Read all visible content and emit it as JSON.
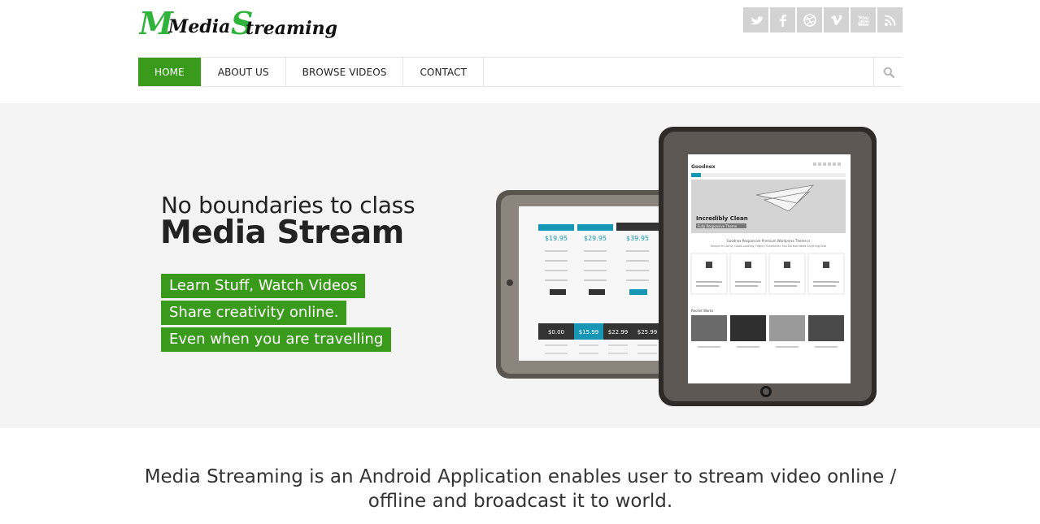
{
  "header": {
    "logo": {
      "part1": "Media",
      "part2": "Streaming"
    },
    "social_icons": [
      "twitter-icon",
      "facebook-icon",
      "dribbble-icon",
      "vimeo-icon",
      "youtube-icon",
      "rss-icon"
    ]
  },
  "nav": {
    "items": [
      "HOME",
      "ABOUT US",
      "BROWSE VIDEOS",
      "CONTACT"
    ],
    "active": "HOME"
  },
  "hero": {
    "subtitle": "No boundaries to class",
    "title": "Media Stream",
    "tags": [
      "Learn Stuff, Watch Videos",
      "Share creativity online.",
      "Even when you are travelling"
    ],
    "tablet_screen": {
      "brand": "Goodnex",
      "banner_title": "Incredibly Clean",
      "banner_sub": "Fully Responsive Theme",
      "tagline": "Goodnex Responsive Premium Wordpress Theme is",
      "tagline2": "Simple in Using, Good-Looking, Highly Functional. You Do Not Need Anything Else",
      "recent": "Recent Works",
      "prices_back": [
        "$19.95",
        "$29.95",
        "$39.95"
      ],
      "prices_front": [
        "$0.00",
        "$15.99",
        "$22.99",
        "$25.99"
      ]
    }
  },
  "intro": {
    "text": "Media Streaming is an Android Application enables user to stream video online / offline and broadcast it to world."
  },
  "colors": {
    "accent": "#3a9a1c",
    "logo_green": "#2fb33a",
    "social_bg": "#d3d3d3",
    "hero_bg": "#f4f4f4",
    "cyan": "#1596b5"
  }
}
